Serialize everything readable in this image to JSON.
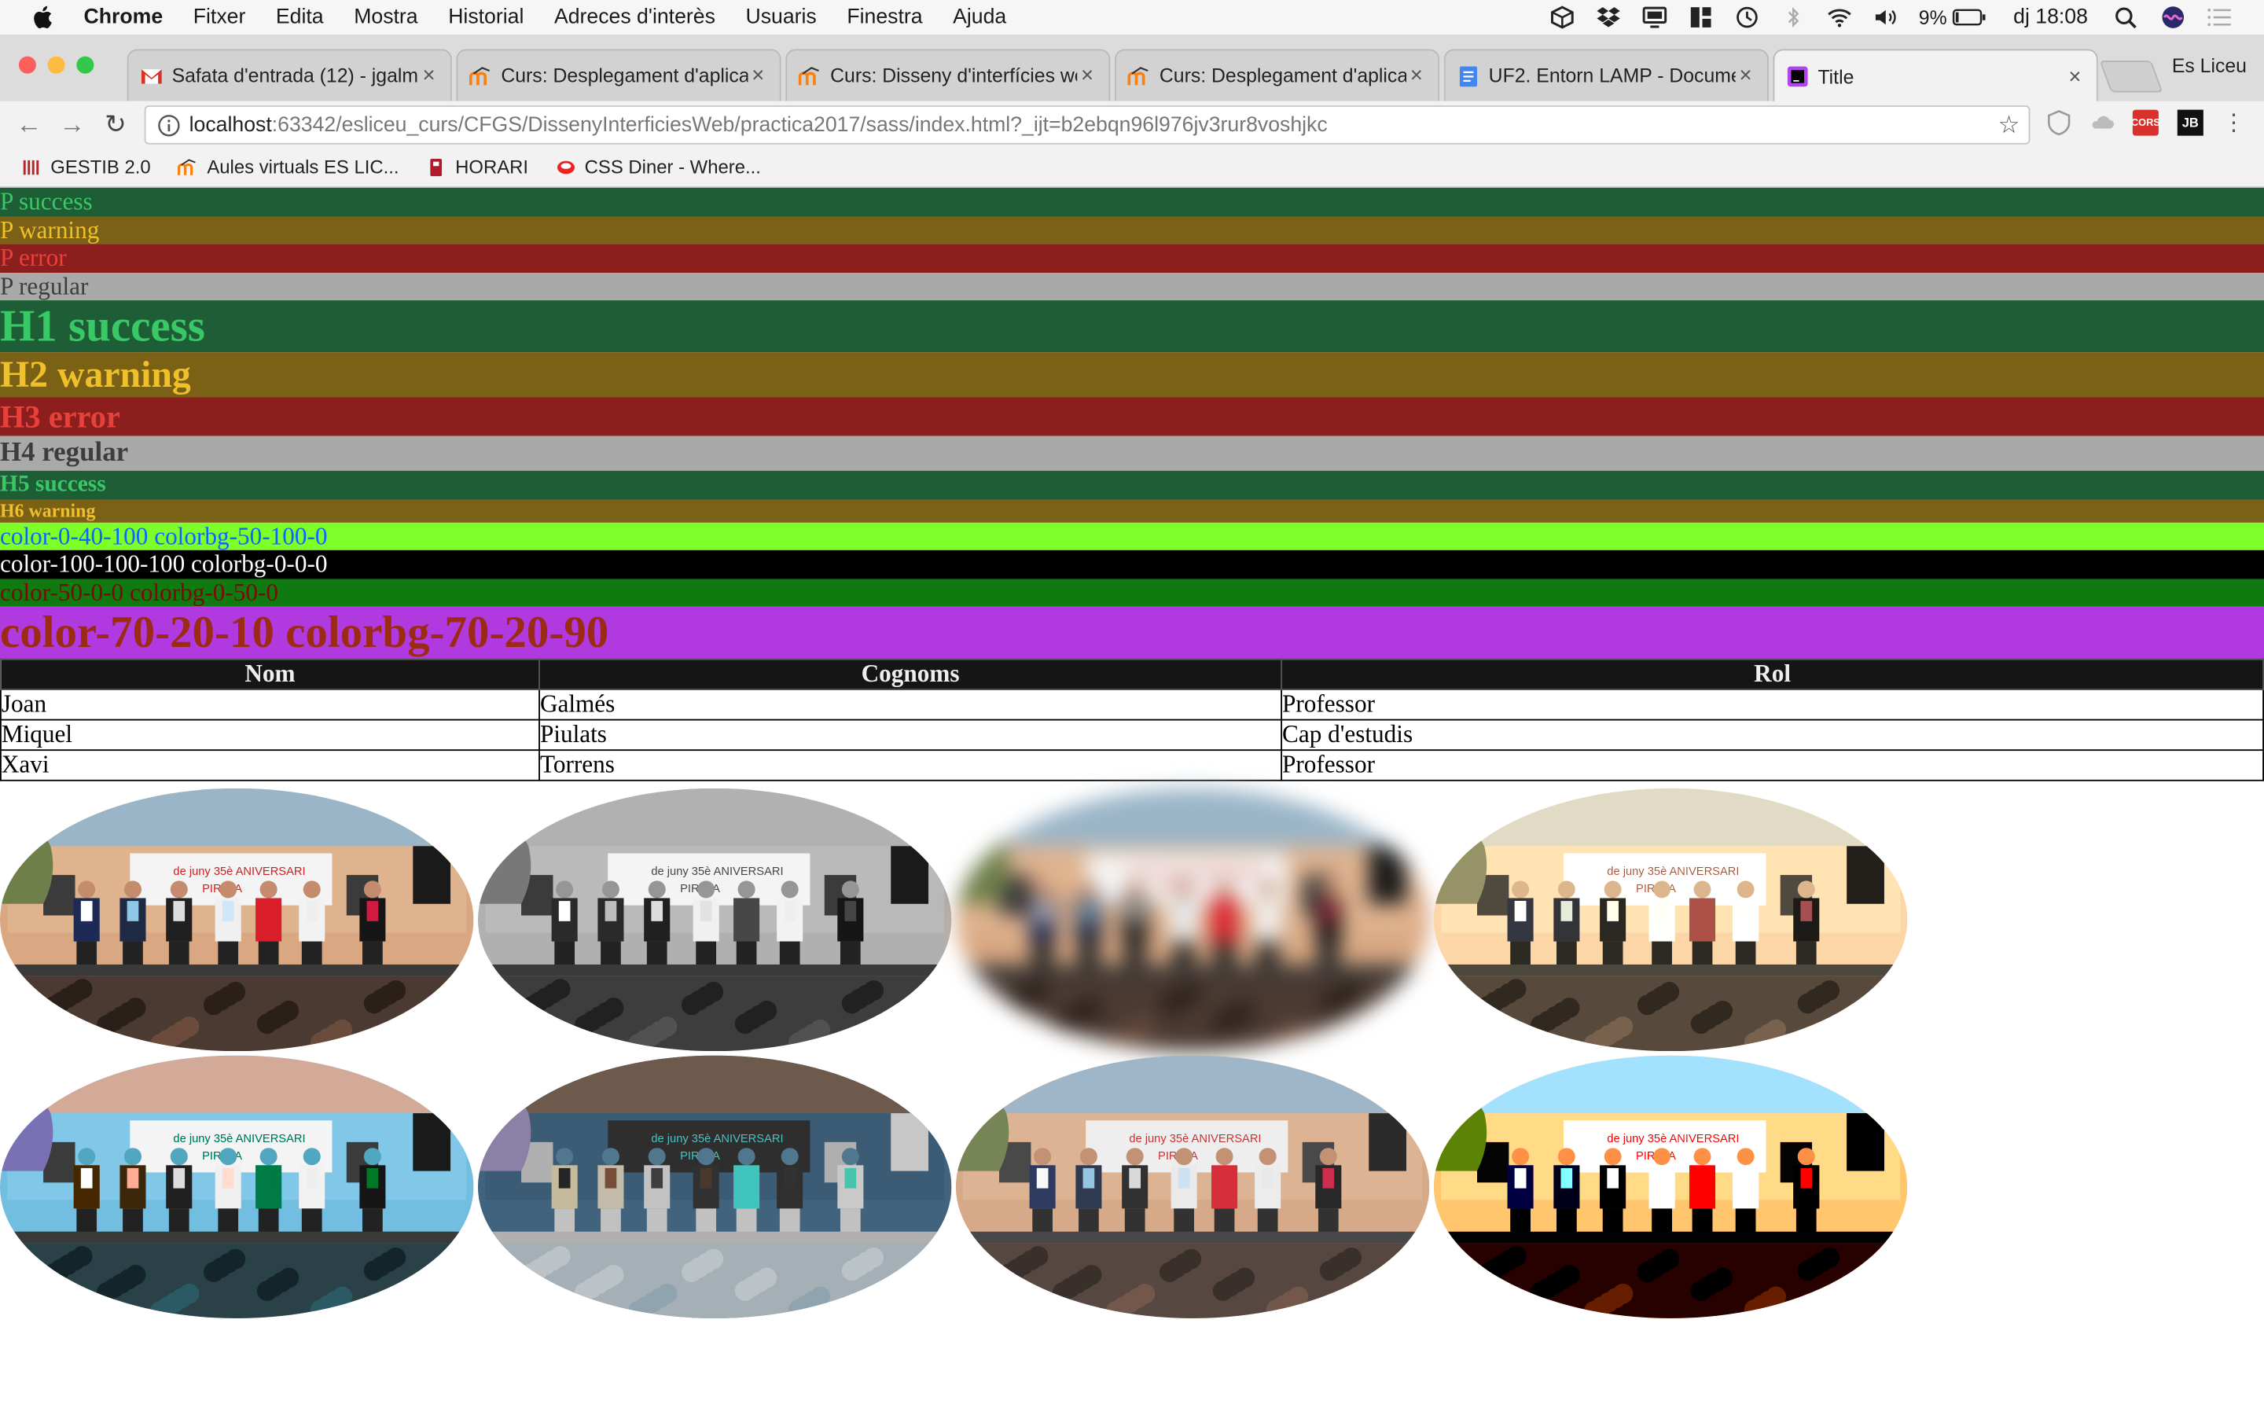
{
  "menubar": {
    "app": "Chrome",
    "items": [
      "Fitxer",
      "Edita",
      "Mostra",
      "Historial",
      "Adreces d'interès",
      "Usuaris",
      "Finestra",
      "Ajuda"
    ],
    "battery": "9%",
    "clock": "dj 18:08"
  },
  "tabs": [
    {
      "title": "Safata d'entrada (12) - jgalmes",
      "icon": "gmail-icon",
      "active": false
    },
    {
      "title": "Curs: Desplegament d'aplicacions",
      "icon": "moodle-icon",
      "active": false
    },
    {
      "title": "Curs: Disseny d'interfícies web",
      "icon": "moodle-icon",
      "active": false
    },
    {
      "title": "Curs: Desplegament d'aplicacions",
      "icon": "moodle-icon",
      "active": false
    },
    {
      "title": "UF2. Entorn LAMP - Documents",
      "icon": "docs-icon",
      "active": false
    },
    {
      "title": "Title",
      "icon": "phpstorm-icon",
      "active": true
    }
  ],
  "profile": "Es Liceu",
  "address": {
    "host": "localhost",
    "rest": ":63342/esliceu_curs/CFGS/DissenyInterficiesWeb/practica2017/sass/index.html?_ijt=b2ebqn96l976jv3rur8voshjkc"
  },
  "bookmarks": [
    {
      "label": "GESTIB 2.0",
      "icon": "gestib-icon"
    },
    {
      "label": "Aules virtuals ES LIC...",
      "icon": "moodle-icon"
    },
    {
      "label": "HORARI",
      "icon": "horari-icon"
    },
    {
      "label": "CSS Diner - Where...",
      "icon": "cssdiner-icon"
    }
  ],
  "extensions": {
    "cors": "CORS",
    "jb": "JB"
  },
  "content": {
    "p_success": "P success",
    "p_warning": "P warning",
    "p_error": "P error",
    "p_regular": "P regular",
    "h1_success": "H1 success",
    "h2_warning": "H2 warning",
    "h3_error": "H3 error",
    "h4_regular": "H4 regular",
    "h5_success": "H5 success",
    "h6_warning": "H6 warning",
    "color1": "color-0-40-100 colorbg-50-100-0",
    "color2": "color-100-100-100 colorbg-0-0-0",
    "color3": "color-50-0-0 colorbg-0-50-0",
    "color4": "color-70-20-10 colorbg-70-20-90"
  },
  "table": {
    "headers": [
      "Nom",
      "Cognoms",
      "Rol"
    ],
    "rows": [
      [
        "Joan",
        "Galmés",
        "Professor"
      ],
      [
        "Miquel",
        "Piulats",
        "Cap d'estudis"
      ],
      [
        "Xavi",
        "Torrens",
        "Professor"
      ]
    ]
  },
  "photos": [
    {
      "name": "photo-normal"
    },
    {
      "name": "photo-grayscale"
    },
    {
      "name": "photo-blur"
    },
    {
      "name": "photo-sepia"
    },
    {
      "name": "photo-hue-rotate"
    },
    {
      "name": "photo-invert"
    },
    {
      "name": "photo-low-contrast"
    },
    {
      "name": "photo-high-contrast"
    }
  ],
  "photo_sign": {
    "line1": "de juny 35è ANIVERSARI",
    "line2": "PIRATA"
  }
}
